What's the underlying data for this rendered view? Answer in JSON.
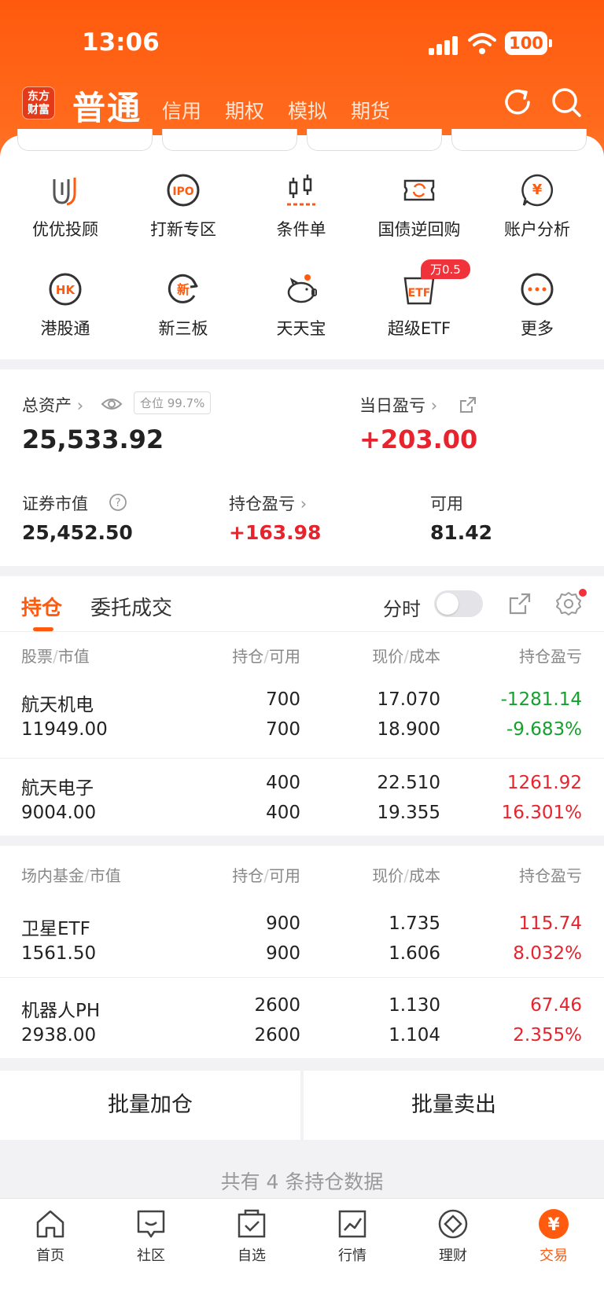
{
  "status": {
    "time": "13:06",
    "battery": "100"
  },
  "header": {
    "logo": "东方财富",
    "active_account": "普通",
    "tabs": [
      "信用",
      "期权",
      "模拟",
      "期货"
    ]
  },
  "quick_actions": [
    {
      "label": "优优投顾",
      "icon": "uu-advisor-icon"
    },
    {
      "label": "打新专区",
      "icon": "ipo-icon"
    },
    {
      "label": "条件单",
      "icon": "candlestick-icon"
    },
    {
      "label": "国债逆回购",
      "icon": "bond-repo-icon"
    },
    {
      "label": "账户分析",
      "icon": "yuan-chat-icon"
    },
    {
      "label": "港股通",
      "icon": "hk-icon"
    },
    {
      "label": "新三板",
      "icon": "new-board-icon"
    },
    {
      "label": "天天宝",
      "icon": "piggy-bank-icon"
    },
    {
      "label": "超级ETF",
      "icon": "etf-icon"
    },
    {
      "label": "更多",
      "icon": "more-icon"
    }
  ],
  "etf_badge": "万0.5",
  "assets": {
    "total_label": "总资产",
    "position_tag": "仓位 99.7%",
    "total_value": "25,533.92",
    "daily_pl_label": "当日盈亏",
    "daily_pl_value": "+203.00",
    "market_value_label": "证券市值",
    "market_value": "25,452.50",
    "holding_pl_label": "持仓盈亏",
    "holding_pl_value": "+163.98",
    "available_label": "可用",
    "available_value": "81.42"
  },
  "holdings": {
    "tab_active": "持仓",
    "tab_other": "委托成交",
    "intraday_label": "分时",
    "stock_header": {
      "c1a": "股票",
      "c1b": "市值",
      "c2a": "持仓",
      "c2b": "可用",
      "c3a": "现价",
      "c3b": "成本",
      "c4": "持仓盈亏"
    },
    "stocks": [
      {
        "name": "航天机电",
        "value": "11949.00",
        "qty": "700",
        "avail": "700",
        "price": "17.070",
        "cost": "18.900",
        "pl": "-1281.14",
        "pl_pct": "-9.683%",
        "dir": "down"
      },
      {
        "name": "航天电子",
        "value": "9004.00",
        "qty": "400",
        "avail": "400",
        "price": "22.510",
        "cost": "19.355",
        "pl": "1261.92",
        "pl_pct": "16.301%",
        "dir": "up"
      }
    ],
    "fund_header": {
      "c1a": "场内基金",
      "c1b": "市值",
      "c2a": "持仓",
      "c2b": "可用",
      "c3a": "现价",
      "c3b": "成本",
      "c4": "持仓盈亏"
    },
    "funds": [
      {
        "name": "卫星ETF",
        "value": "1561.50",
        "qty": "900",
        "avail": "900",
        "price": "1.735",
        "cost": "1.606",
        "pl": "115.74",
        "pl_pct": "8.032%",
        "dir": "up"
      },
      {
        "name": "机器人PH",
        "value": "2938.00",
        "qty": "2600",
        "avail": "2600",
        "price": "1.130",
        "cost": "1.104",
        "pl": "67.46",
        "pl_pct": "2.355%",
        "dir": "up"
      }
    ]
  },
  "actions": {
    "batch_add": "批量加仓",
    "batch_sell": "批量卖出"
  },
  "summary": "共有 4 条持仓数据",
  "tabbar": [
    {
      "label": "首页",
      "icon": "home-icon"
    },
    {
      "label": "社区",
      "icon": "community-icon"
    },
    {
      "label": "自选",
      "icon": "watchlist-icon"
    },
    {
      "label": "行情",
      "icon": "market-icon"
    },
    {
      "label": "理财",
      "icon": "wealth-icon"
    },
    {
      "label": "交易",
      "icon": "trade-icon"
    }
  ],
  "colors": {
    "brand": "#ff5a0e",
    "up": "#e8232d",
    "down": "#16a02d"
  }
}
